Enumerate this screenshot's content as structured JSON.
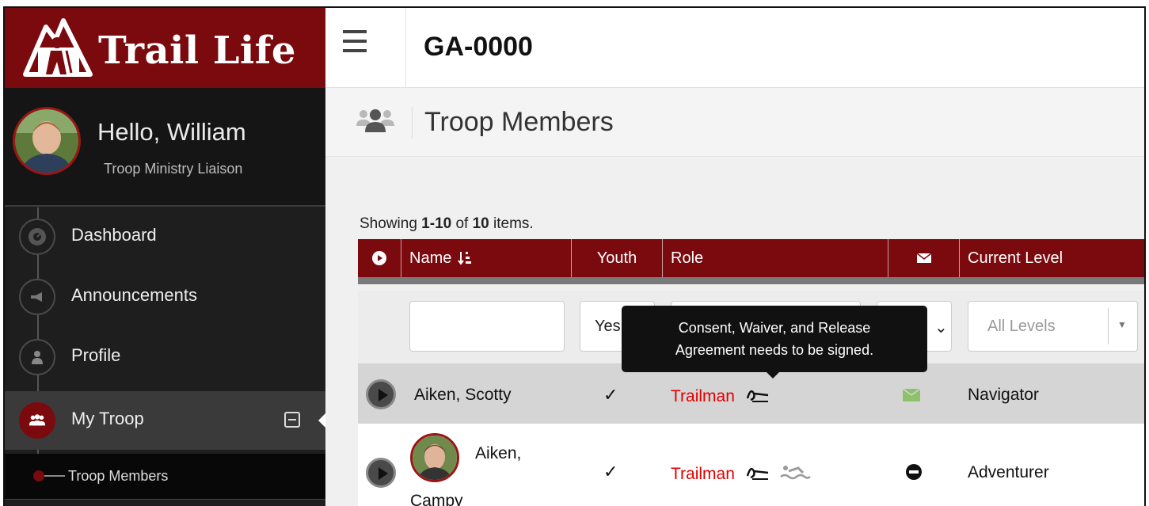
{
  "brand": {
    "name": "Trail Life"
  },
  "user": {
    "greeting": "Hello, William",
    "title": "Troop Ministry Liaison"
  },
  "sidebar": {
    "items": [
      {
        "label": "Dashboard",
        "icon": "dashboard-icon"
      },
      {
        "label": "Announcements",
        "icon": "megaphone-icon"
      },
      {
        "label": "Profile",
        "icon": "user-icon"
      },
      {
        "label": "My Troop",
        "icon": "users-icon",
        "active": true
      }
    ],
    "subitems": [
      {
        "label": "Troop Members"
      }
    ]
  },
  "header": {
    "troop_code": "GA-0000"
  },
  "page": {
    "title": "Troop Members"
  },
  "summary": {
    "prefix": "Showing ",
    "range": "1-10",
    "middle": " of ",
    "total": "10",
    "suffix": " items."
  },
  "table": {
    "columns": {
      "name": "Name",
      "youth": "Youth",
      "role": "Role",
      "current_level": "Current Level"
    },
    "filters": {
      "name_value": "",
      "youth_value": "Yes",
      "level_placeholder": "All Levels"
    },
    "rows": [
      {
        "name": "Aiken, Scotty",
        "youth": "✓",
        "role": "Trailman",
        "level": "Navigator",
        "email_status": "email-ok"
      },
      {
        "name_line1": "Aiken,",
        "name_line2": "Campy",
        "youth": "✓",
        "role": "Trailman",
        "level": "Adventurer",
        "email_status": "no-entry"
      }
    ]
  },
  "tooltip": {
    "line1": "Consent, Waiver, and Release",
    "line2": "Agreement needs to be signed."
  },
  "colors": {
    "brand": "#7b0a0f",
    "sidebar": "#1e1e1e",
    "role_text": "#e30000",
    "header_gray": "#7a7a7a"
  }
}
